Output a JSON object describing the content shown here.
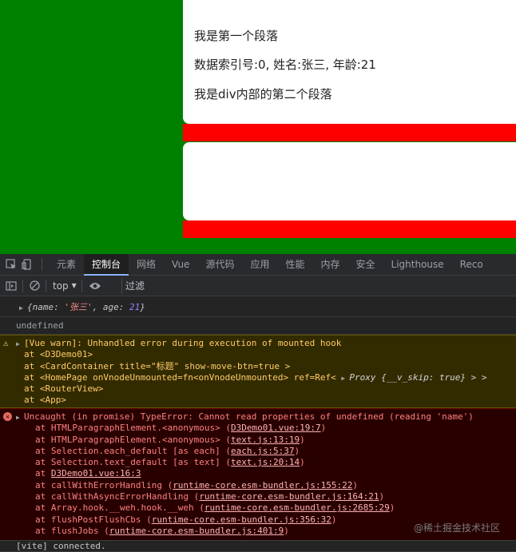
{
  "app": {
    "p1": "我是第一个段落",
    "p2": "数据索引号:0, 姓名:张三, 年龄:21",
    "p3": "我是div内部的第二个段落"
  },
  "devtools": {
    "tabs": [
      "元素",
      "控制台",
      "网络",
      "Vue",
      "源代码",
      "应用",
      "性能",
      "内存",
      "安全",
      "Lighthouse",
      "Reco"
    ],
    "active_tab": "控制台",
    "context": "top",
    "filter_placeholder": "过滤"
  },
  "console": {
    "obj": {
      "open": "{",
      "k1": "name",
      "colon1": ": ",
      "v1": "'张三'",
      "sep": ", ",
      "k2": "age",
      "colon2": ": ",
      "v2": "21",
      "close": "}"
    },
    "undef": "undefined",
    "warn": {
      "title": "[Vue warn]: Unhandled error during execution of mounted hook",
      "lines": [
        "at <D3Demo01>",
        "at <CardContainer title=\"标题\" show-move-btn=true >",
        "at <HomePage onVnodeUnmounted=fn<onVnodeUnmounted> ref=Ref<",
        "at <RouterView>",
        "at <App>"
      ],
      "proxy": "Proxy {__v_skip: true} > >"
    },
    "error": {
      "title": "Uncaught (in promise) TypeError: Cannot read properties of undefined (reading 'name')",
      "frames": [
        {
          "pre": "at HTMLParagraphElement.<anonymous> (",
          "link": "D3Demo01.vue:19:7",
          "post": ")"
        },
        {
          "pre": "at HTMLParagraphElement.<anonymous> (",
          "link": "text.js:13:19",
          "post": ")"
        },
        {
          "pre": "at Selection.each_default [as each] (",
          "link": "each.js:5:37",
          "post": ")"
        },
        {
          "pre": "at Selection.text_default [as text] (",
          "link": "text.js:20:14",
          "post": ")"
        },
        {
          "pre": "at ",
          "link": "D3Demo01.vue:16:3",
          "post": ""
        },
        {
          "pre": "at callWithErrorHandling (",
          "link": "runtime-core.esm-bundler.js:155:22",
          "post": ")"
        },
        {
          "pre": "at callWithAsyncErrorHandling (",
          "link": "runtime-core.esm-bundler.js:164:21",
          "post": ")"
        },
        {
          "pre": "at Array.hook.__weh.hook.__weh (",
          "link": "runtime-core.esm-bundler.js:2685:29",
          "post": ")"
        },
        {
          "pre": "at flushPostFlushCbs (",
          "link": "runtime-core.esm-bundler.js:356:32",
          "post": ")"
        },
        {
          "pre": "at flushJobs (",
          "link": "runtime-core.esm-bundler.js:401:9",
          "post": ")"
        }
      ]
    },
    "vite": "[vite] connected."
  },
  "watermark": "@稀土掘金技术社区",
  "colors": {
    "app_bg": "#008000",
    "strip": "#ff0000",
    "card": "#ffffff"
  }
}
